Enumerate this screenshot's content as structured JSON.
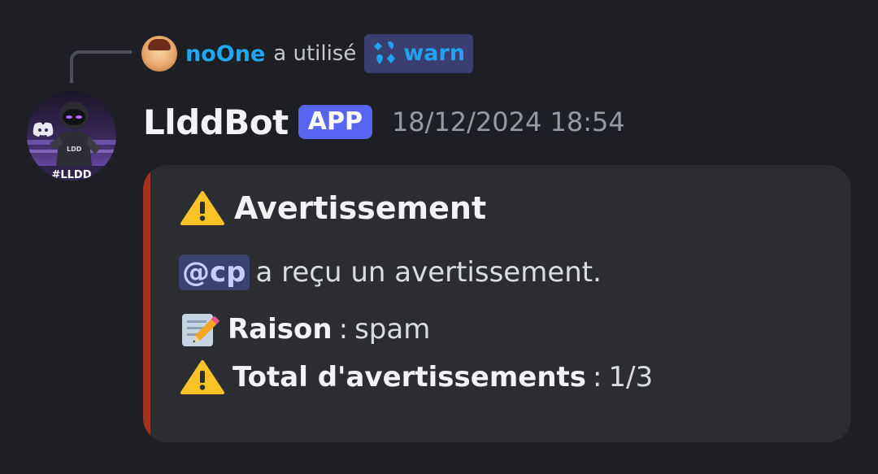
{
  "reply": {
    "user": "noOne",
    "action_text": "a utilisé",
    "command": "warn",
    "command_icon": "command-icon"
  },
  "message": {
    "author": "LlddBot",
    "badge": "APP",
    "timestamp": "18/12/2024 18:54",
    "avatar_text": "#LLDD"
  },
  "embed": {
    "accent_color": "#a5321f",
    "title": "Avertissement",
    "title_icon": "warning-icon",
    "mention": "@cp",
    "line1_text": "a reçu un avertissement.",
    "reason_label": "Raison",
    "reason_sep": ":",
    "reason_value": "spam",
    "reason_icon": "memo-icon",
    "total_label": "Total d'avertissements",
    "total_sep": ":",
    "total_value": "1/3",
    "total_icon": "warning-icon"
  }
}
